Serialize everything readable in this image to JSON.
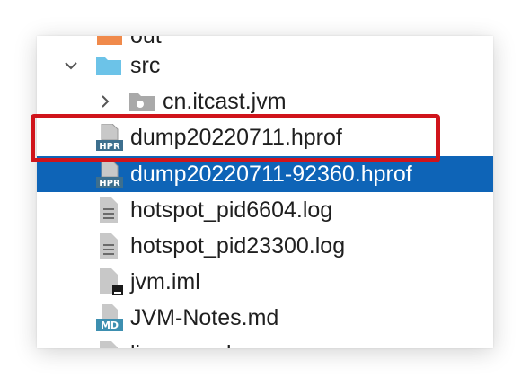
{
  "tree": {
    "items": [
      {
        "label": "out",
        "icon": "folder-orange-icon"
      },
      {
        "label": "src",
        "icon": "folder-icon",
        "expanded": true
      },
      {
        "label": "cn.itcast.jvm",
        "icon": "package-icon",
        "expanded": false
      },
      {
        "label": "dump20220711.hprof",
        "icon": "hprof-file-icon"
      },
      {
        "label": "dump20220711-92360.hprof",
        "icon": "hprof-file-icon",
        "selected": true
      },
      {
        "label": "hotspot_pid6604.log",
        "icon": "text-file-icon"
      },
      {
        "label": "hotspot_pid23300.log",
        "icon": "text-file-icon"
      },
      {
        "label": "jvm.iml",
        "icon": "iml-file-icon"
      },
      {
        "label": "JVM-Notes.md",
        "icon": "markdown-file-icon"
      },
      {
        "label": "linux words",
        "icon": "text-file-icon"
      }
    ],
    "icon_badges": {
      "hprof": "HPR",
      "markdown": "MD"
    }
  },
  "colors": {
    "selection": "#0e64b7",
    "highlight_border": "#d0141b",
    "folder_blue": "#6cc3e8",
    "folder_orange": "#f08a4b"
  }
}
